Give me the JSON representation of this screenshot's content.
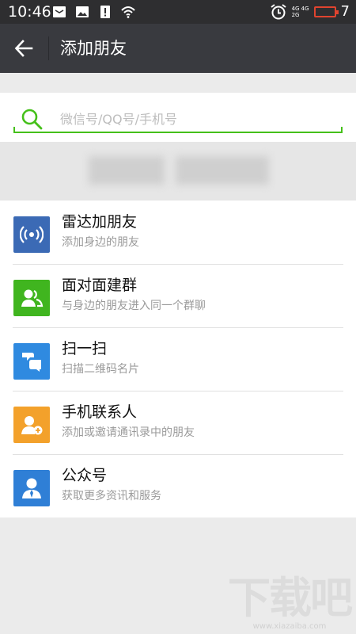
{
  "status_bar": {
    "time": "10:46",
    "network_top": "4G 4G",
    "network_bottom": "2G",
    "battery_level": "7",
    "icons": [
      "message-icon",
      "image-icon",
      "alert-icon",
      "wifi-icon",
      "alarm-icon",
      "signal-icon",
      "battery-icon"
    ]
  },
  "app_bar": {
    "title": "添加朋友",
    "back_icon": "arrow-left-icon"
  },
  "search": {
    "placeholder": "微信号/QQ号/手机号",
    "value": "",
    "icon": "search-icon",
    "accent": "#45c01a"
  },
  "items": [
    {
      "title": "雷达加朋友",
      "subtitle": "添加身边的朋友",
      "icon": "radar-icon",
      "color": "#3b6ab5"
    },
    {
      "title": "面对面建群",
      "subtitle": "与身边的朋友进入同一个群聊",
      "icon": "group-icon",
      "color": "#40b51f"
    },
    {
      "title": "扫一扫",
      "subtitle": "扫描二维码名片",
      "icon": "scan-icon",
      "color": "#2f8ae0"
    },
    {
      "title": "手机联系人",
      "subtitle": "添加或邀请通讯录中的朋友",
      "icon": "contact-add-icon",
      "color": "#f3a12b"
    },
    {
      "title": "公众号",
      "subtitle": "获取更多资讯和服务",
      "icon": "official-account-icon",
      "color": "#2f7fd6"
    }
  ],
  "watermark": {
    "main": "下载吧",
    "url": "www.xiazaiba.com"
  }
}
